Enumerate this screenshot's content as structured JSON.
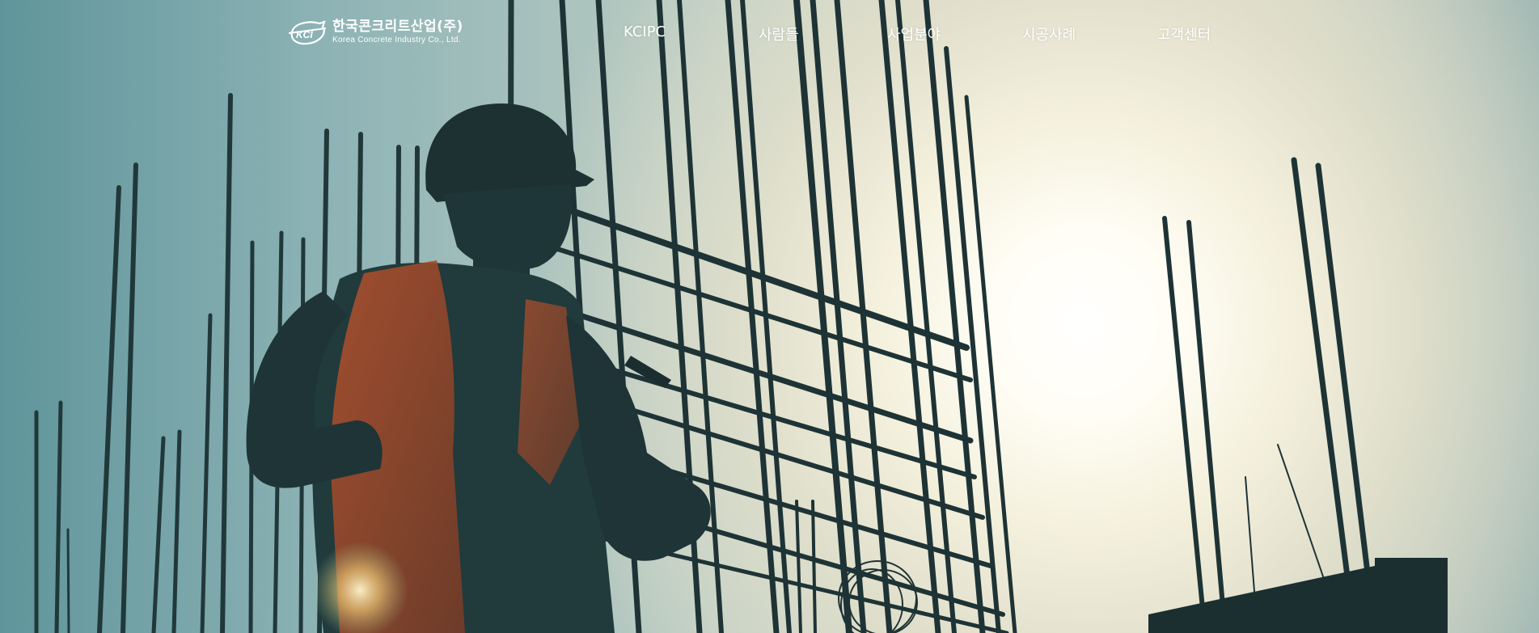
{
  "header": {
    "logo": {
      "korean": "한국콘크리트산업(주)",
      "english": "Korea Concrete Industry Co., Ltd.",
      "mark_text": "KCI"
    },
    "nav": [
      {
        "label": "KCIPC"
      },
      {
        "label": "사람들"
      },
      {
        "label": "사업분야"
      },
      {
        "label": "시공사례"
      },
      {
        "label": "고객센터"
      }
    ]
  },
  "hero": {
    "image": "silhouette of construction worker in hard hat and safety vest tying rebar cage against sun",
    "colors": {
      "sky_left": "#5f959b",
      "sky_mid": "#d5d8c8",
      "sun": "#ffffff",
      "silhouette": "#1f3a3c",
      "vest": "#c8582a"
    }
  }
}
